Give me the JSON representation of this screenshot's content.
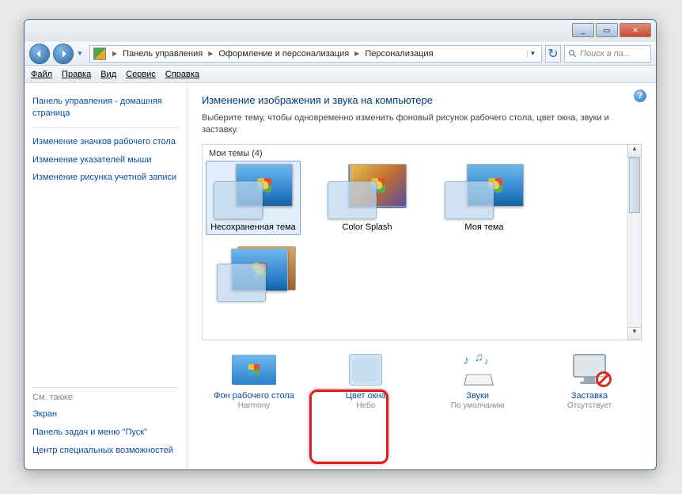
{
  "titlebar": {
    "min": "_",
    "max": "▭",
    "close": "✕"
  },
  "nav": {
    "breadcrumb": [
      "Панель управления",
      "Оформление и персонализация",
      "Персонализация"
    ],
    "search_placeholder": "Поиск в па..."
  },
  "menu": {
    "file": "Файл",
    "edit": "Правка",
    "view": "Вид",
    "service": "Сервис",
    "help": "Справка"
  },
  "sidebar": {
    "home": "Панель управления - домашняя страница",
    "links": [
      "Изменение значков рабочего стола",
      "Изменение указателей мыши",
      "Изменение рисунка учетной записи"
    ],
    "see_also_hdr": "См. также",
    "see_also": [
      "Экран",
      "Панель задач и меню \"Пуск\"",
      "Центр специальных возможностей"
    ]
  },
  "main": {
    "title": "Изменение изображения и звука на компьютере",
    "desc": "Выберите тему, чтобы одновременно изменить фоновый рисунок рабочего стола, цвет окна, звуки и заставку.",
    "themes_hdr": "Мои темы (4)",
    "themes": [
      {
        "label": "Несохраненная тема"
      },
      {
        "label": "Color Splash"
      },
      {
        "label": "Моя тема"
      },
      {
        "label": ""
      }
    ],
    "bottom": [
      {
        "label": "Фон рабочего стола",
        "sub": "Harmony"
      },
      {
        "label": "Цвет окна",
        "sub": "Небо"
      },
      {
        "label": "Звуки",
        "sub": "По умолчанию"
      },
      {
        "label": "Заставка",
        "sub": "Отсутствует"
      }
    ]
  }
}
